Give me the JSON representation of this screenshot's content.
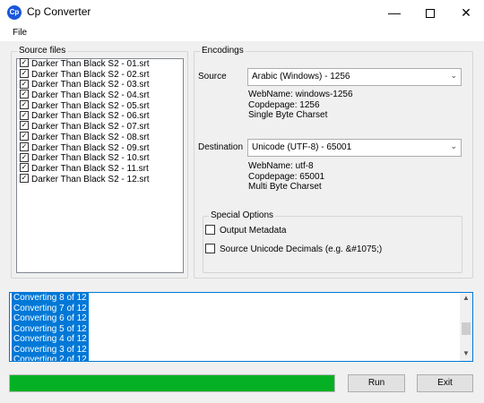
{
  "window": {
    "title": "Cp Converter",
    "icon_text": "Cp"
  },
  "menu": {
    "file": "File"
  },
  "source_files": {
    "title": "Source files",
    "items": [
      "Darker Than Black S2 - 01.srt",
      "Darker Than Black S2 - 02.srt",
      "Darker Than Black S2 - 03.srt",
      "Darker Than Black S2 - 04.srt",
      "Darker Than Black S2 - 05.srt",
      "Darker Than Black S2 - 06.srt",
      "Darker Than Black S2 - 07.srt",
      "Darker Than Black S2 - 08.srt",
      "Darker Than Black S2 - 09.srt",
      "Darker Than Black S2 - 10.srt",
      "Darker Than Black S2 - 11.srt",
      "Darker Than Black S2 - 12.srt"
    ]
  },
  "encodings": {
    "title": "Encodings",
    "source": {
      "label": "Source",
      "selected": "Arabic (Windows) - 1256",
      "webname": "WebName: windows-1256",
      "codepage": "Copdepage: 1256",
      "charset": "Single Byte Charset"
    },
    "destination": {
      "label": "Destination",
      "selected": "Unicode (UTF-8) - 65001",
      "webname": "WebName: utf-8",
      "codepage": "Copdepage: 65001",
      "charset": "Multi Byte Charset"
    }
  },
  "special_options": {
    "title": "Special Options",
    "output_metadata": "Output Metadata",
    "source_unicode_decimals": "Source Unicode Decimals (e.g. &#1075;)"
  },
  "log": [
    "Converting 8 of 12",
    "Converting 7 of 12",
    "Converting 6 of 12",
    "Converting 5 of 12",
    "Converting 4 of 12",
    "Converting 3 of 12",
    "Converting 2 of 12"
  ],
  "progress": {
    "percent": 100,
    "color": "#06b025"
  },
  "buttons": {
    "run": "Run",
    "exit": "Exit"
  }
}
